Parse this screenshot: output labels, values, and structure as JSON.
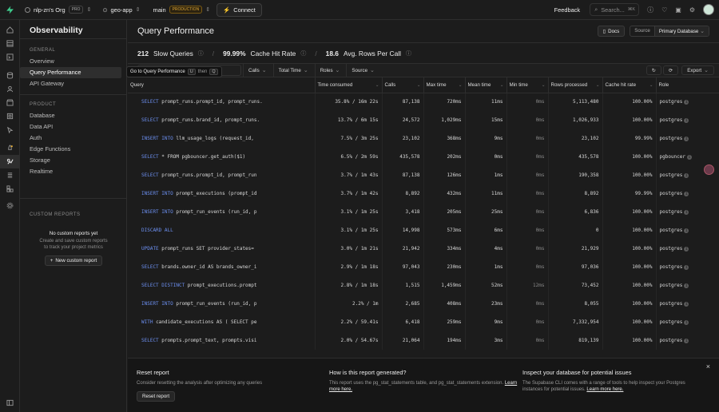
{
  "topbar": {
    "org": "nlp-zn's Org",
    "org_badge": "PRO",
    "project": "geo-app",
    "branch": "main",
    "branch_badge": "PRODUCTION",
    "connect": "Connect",
    "feedback": "Feedback",
    "search_placeholder": "Search...",
    "search_shortcut": "⌘K"
  },
  "sidenav": {
    "title": "Observability",
    "general_title": "GENERAL",
    "general_items": [
      "Overview",
      "Query Performance",
      "API Gateway"
    ],
    "product_title": "PRODUCT",
    "product_items": [
      "Database",
      "Data API",
      "Auth",
      "Edge Functions",
      "Storage",
      "Realtime"
    ],
    "custom_title": "CUSTOM REPORTS",
    "custom_empty_title": "No custom reports yet",
    "custom_empty_desc": "Create and save custom reports to track your project metrics",
    "new_report": "New custom report"
  },
  "page": {
    "title": "Query Performance",
    "docs": "Docs",
    "source_label": "Source",
    "source_value": "Primary Database"
  },
  "stats": {
    "slow_queries_value": "212",
    "slow_queries_label": "Slow Queries",
    "cache_hit_value": "99.99%",
    "cache_hit_label": "Cache Hit Rate",
    "rows_per_call_value": "18.6",
    "rows_per_call_label": "Avg. Rows Per Call"
  },
  "filters": {
    "tooltip_text": "Go to Query Performance",
    "tooltip_key1": "U",
    "tooltip_then": "then",
    "tooltip_key2": "Q",
    "calls": "Calls",
    "total_time": "Total Time",
    "roles": "Roles",
    "source": "Source",
    "export": "Export"
  },
  "table": {
    "headers": [
      "Query",
      "Time consumed",
      "Calls",
      "Max time",
      "Mean time",
      "Min time",
      "Rows processed",
      "Cache hit rate",
      "Role"
    ],
    "rows": [
      {
        "kw": "SELECT",
        "rest": " prompt_runs.prompt_id, prompt_runs.",
        "time": "35.8% / 16m 22s",
        "calls": "87,138",
        "max": "720ms",
        "mean": "11ms",
        "min": "0ms",
        "rows": "5,113,480",
        "cache": "100.00%",
        "role": "postgres"
      },
      {
        "kw": "SELECT",
        "rest": " prompt_runs.brand_id, prompt_runs.",
        "time": "13.7% / 6m 15s",
        "calls": "24,572",
        "max": "1,029ms",
        "mean": "15ms",
        "min": "0ms",
        "rows": "1,026,933",
        "cache": "100.00%",
        "role": "postgres"
      },
      {
        "kw": "INSERT INTO",
        "rest": " llm_usage_logs (request_id, ",
        "time": "7.5% / 3m 25s",
        "calls": "23,102",
        "max": "368ms",
        "mean": "9ms",
        "min": "0ms",
        "rows": "23,102",
        "cache": "99.99%",
        "role": "postgres"
      },
      {
        "kw": "SELECT",
        "rest": " * FROM pgbouncer.get_auth($1)",
        "time": "6.5% / 2m 59s",
        "calls": "435,578",
        "max": "202ms",
        "mean": "0ms",
        "min": "0ms",
        "rows": "435,578",
        "cache": "100.00%",
        "role": "pgbouncer"
      },
      {
        "kw": "SELECT",
        "rest": " prompt_runs.prompt_id, prompt_run",
        "time": "3.7% / 1m 43s",
        "calls": "87,138",
        "max": "126ms",
        "mean": "1ms",
        "min": "0ms",
        "rows": "190,358",
        "cache": "100.00%",
        "role": "postgres"
      },
      {
        "kw": "INSERT INTO",
        "rest": " prompt_executions (prompt_id",
        "time": "3.7% / 1m 42s",
        "calls": "8,892",
        "max": "432ms",
        "mean": "11ms",
        "min": "0ms",
        "rows": "8,892",
        "cache": "99.99%",
        "role": "postgres"
      },
      {
        "kw": "INSERT INTO",
        "rest": " prompt_run_events (run_id, p",
        "time": "3.1% / 1m 25s",
        "calls": "3,418",
        "max": "205ms",
        "mean": "25ms",
        "min": "0ms",
        "rows": "6,836",
        "cache": "100.00%",
        "role": "postgres"
      },
      {
        "kw": "DISCARD ALL",
        "rest": "",
        "time": "3.1% / 1m 25s",
        "calls": "14,998",
        "max": "573ms",
        "mean": "6ms",
        "min": "0ms",
        "rows": "0",
        "cache": "100.00%",
        "role": "postgres"
      },
      {
        "kw": "UPDATE",
        "rest": " prompt_runs SET provider_states=",
        "time": "3.0% / 1m 21s",
        "calls": "21,942",
        "max": "334ms",
        "mean": "4ms",
        "min": "0ms",
        "rows": "21,929",
        "cache": "100.00%",
        "role": "postgres"
      },
      {
        "kw": "SELECT",
        "rest": " brands.owner_id AS brands_owner_i",
        "time": "2.9% / 1m 18s",
        "calls": "97,043",
        "max": "230ms",
        "mean": "1ms",
        "min": "0ms",
        "rows": "97,036",
        "cache": "100.00%",
        "role": "postgres"
      },
      {
        "kw": "SELECT DISTINCT",
        "rest": " prompt_executions.prompt",
        "time": "2.8% / 1m 18s",
        "calls": "1,515",
        "max": "1,459ms",
        "mean": "52ms",
        "min": "12ms",
        "rows": "73,452",
        "cache": "100.00%",
        "role": "postgres"
      },
      {
        "kw": "INSERT INTO",
        "rest": " prompt_run_events (run_id, p",
        "time": "2.2% / 1m",
        "calls": "2,685",
        "max": "408ms",
        "mean": "23ms",
        "min": "0ms",
        "rows": "8,055",
        "cache": "100.00%",
        "role": "postgres"
      },
      {
        "kw": "WITH",
        "rest": " candidate_executions AS ( SELECT pe",
        "time": "2.2% / 59.41s",
        "calls": "6,418",
        "max": "259ms",
        "mean": "9ms",
        "min": "0ms",
        "rows": "7,332,954",
        "cache": "100.00%",
        "role": "postgres"
      },
      {
        "kw": "SELECT",
        "rest": " prompts.prompt_text, prompts.visi",
        "time": "2.0% / 54.67s",
        "calls": "21,064",
        "max": "194ms",
        "mean": "3ms",
        "min": "0ms",
        "rows": "819,139",
        "cache": "100.00%",
        "role": "postgres"
      }
    ]
  },
  "footer": {
    "reset_title": "Reset report",
    "reset_desc": "Consider resetting the analysis after optimizing any queries",
    "reset_button": "Reset report",
    "how_title": "How is this report generated?",
    "how_desc": "This report uses the pg_stat_statements table, and pg_stat_statements extension.",
    "how_link": "Learn more here.",
    "inspect_title": "Inspect your database for potential issues",
    "inspect_desc": "The Supabase CLI comes with a range of tools to help inspect your Postgres instances for potential issues.",
    "inspect_link": "Learn more here."
  },
  "colors": {
    "accent": "#3ecf8e",
    "keyword": "#6c8ff0",
    "production_badge": "#e0a833"
  }
}
